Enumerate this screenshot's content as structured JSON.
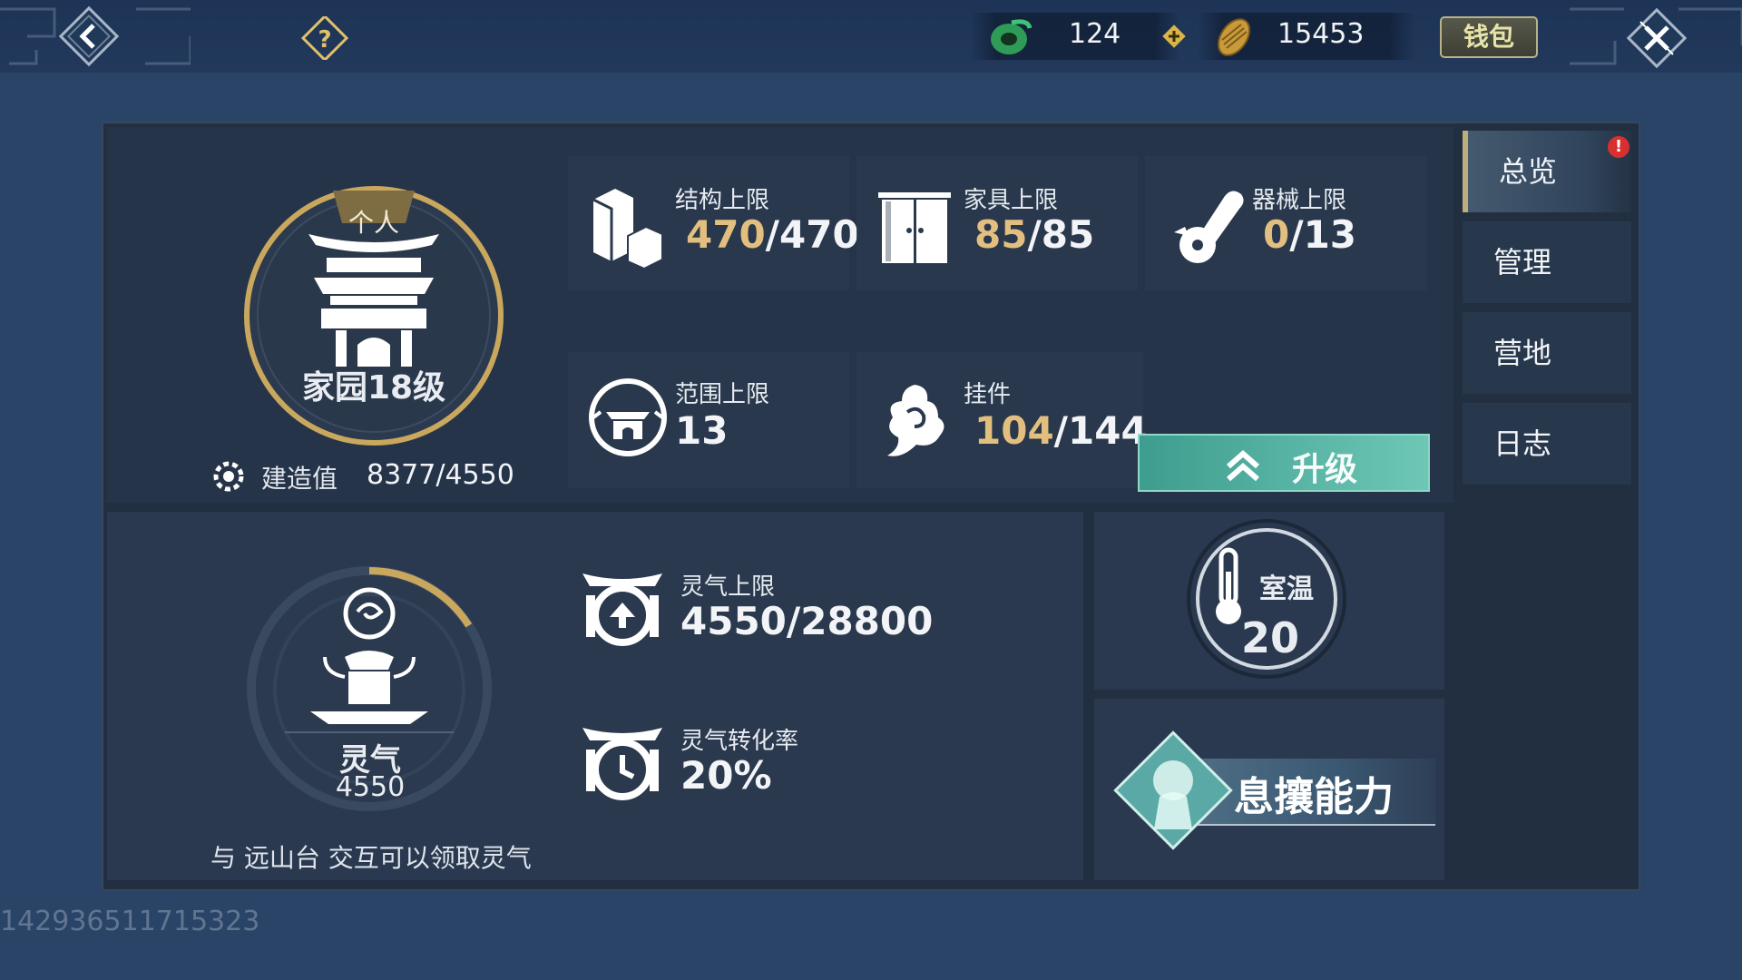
{
  "currency": {
    "jade_amount": "124",
    "coin_amount": "15453",
    "wallet_label": "钱包"
  },
  "home": {
    "mode_badge": "个人",
    "level_label": "家园18级",
    "build_label": "建造值",
    "build_value": "8377/4550"
  },
  "stats": {
    "structure": {
      "label": "结构上限",
      "current": "470",
      "max": "/470"
    },
    "furniture": {
      "label": "家具上限",
      "current": "85",
      "max": "/85"
    },
    "machinery": {
      "label": "器械上限",
      "current": "0",
      "max": "/13"
    },
    "range": {
      "label": "范围上限",
      "value": "13"
    },
    "pendant": {
      "label": "挂件",
      "current": "104",
      "max": "/144"
    }
  },
  "upgrade_label": "升级",
  "aura": {
    "name": "灵气",
    "value": "4550",
    "hint": "与 远山台 交互可以领取灵气",
    "ring_fraction": 0.16,
    "cap_label": "灵气上限",
    "cap_value": "4550/28800",
    "rate_label": "灵气转化率",
    "rate_value": "20%"
  },
  "temperature": {
    "label": "室温",
    "value": "20"
  },
  "ability_label": "息攘能力",
  "tabs": [
    "总览",
    "管理",
    "营地",
    "日志"
  ],
  "alert_mark": "!",
  "watermark": "142936511715323",
  "colors": {
    "accent_gold": "#e3bf7f",
    "upgrade_teal": "#56b3a3",
    "alert_red": "#d92f2f"
  }
}
